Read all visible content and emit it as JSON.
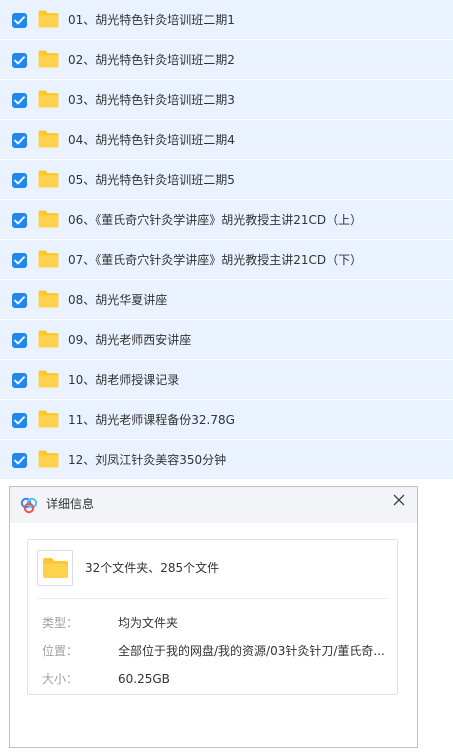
{
  "file_list": {
    "items": [
      {
        "label": "01、胡光特色针灸培训班二期1"
      },
      {
        "label": "02、胡光特色针灸培训班二期2"
      },
      {
        "label": "03、胡光特色针灸培训班二期3"
      },
      {
        "label": "04、胡光特色针灸培训班二期4"
      },
      {
        "label": "05、胡光特色针灸培训班二期5"
      },
      {
        "label": "06、《董氏奇穴针灸学讲座》胡光教授主讲21CD（上）"
      },
      {
        "label": "07、《董氏奇穴针灸学讲座》胡光教授主讲21CD（下）"
      },
      {
        "label": "08、胡光华夏讲座"
      },
      {
        "label": "09、胡光老师西安讲座"
      },
      {
        "label": "10、胡老师授课记录"
      },
      {
        "label": "11、胡光老师课程备份32.78G"
      },
      {
        "label": "12、刘凤江针灸美容350分钟"
      }
    ],
    "checked": true
  },
  "details_dialog": {
    "title": "详细信息",
    "summary": "32个文件夹、285个文件",
    "type_label": "类型：",
    "type_value": "均为文件夹",
    "location_label": "位置：",
    "location_value": "全部位于我的网盘/我的资源/03针灸针刀/董氏奇...",
    "size_label": "大小：",
    "size_value": "60.25GB"
  },
  "colors": {
    "row_bg": "#e9f2fe",
    "checkbox": "#1f88f3",
    "folder": "#fcc932"
  },
  "icons": {
    "checkbox": "checkbox-checked-icon",
    "folder": "folder-icon",
    "close": "close-icon",
    "logo": "baidu-netdisk-logo-icon"
  }
}
